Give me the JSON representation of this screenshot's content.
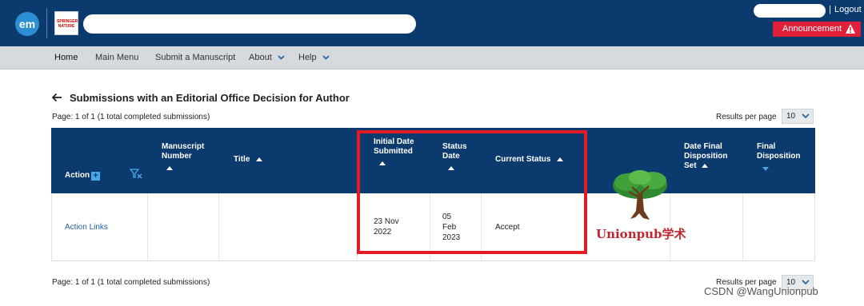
{
  "header": {
    "logo_text": "em",
    "publisher_logo_text": "SPRINGER NATURE",
    "separator": "|",
    "logout_label": "Logout",
    "announcement_label": "Announcement"
  },
  "nav": {
    "items": [
      {
        "label": "Home"
      },
      {
        "label": "Main Menu"
      },
      {
        "label": "Submit a Manuscript"
      },
      {
        "label": "About"
      },
      {
        "label": "Help"
      }
    ]
  },
  "page": {
    "title": "Submissions with an Editorial Office Decision for Author",
    "pagination_text": "Page: 1 of 1 (1 total completed submissions)",
    "results_per_page_label": "Results per page",
    "results_per_page_value": "10"
  },
  "table": {
    "headers": {
      "action": "Action",
      "manuscript_number": "Manuscript Number",
      "title": "Title",
      "initial_date": "Initial Date Submitted",
      "status_date": "Status Date",
      "current_status": "Current Status",
      "date_final": "Date Final Disposition Set",
      "final_disposition": "Final Disposition"
    },
    "rows": [
      {
        "action": "Action Links",
        "manuscript_number": "",
        "title": "",
        "initial_date": "23 Nov 2022",
        "status_date": "05 Feb 2023",
        "current_status": "Accept",
        "date_final": "",
        "final_disposition": ""
      }
    ]
  },
  "watermark": {
    "brand_text": "Unionpub学术",
    "csdn_text": "CSDN @WangUnionpub"
  },
  "colors": {
    "header_bg": "#0b3a6e",
    "nav_bg": "#d7dadd",
    "announcement_bg": "#e0203a",
    "highlight_border": "#e21b25",
    "link": "#1f5fa5"
  }
}
